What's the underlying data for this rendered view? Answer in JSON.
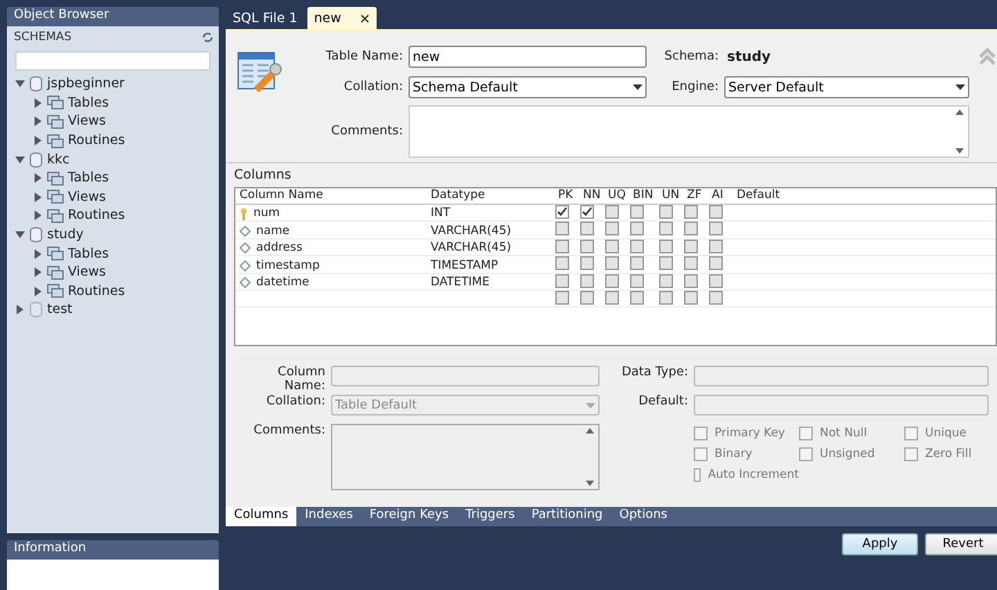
{
  "object_browser": {
    "title": "Object Browser",
    "section": "SCHEMAS",
    "schemas": [
      {
        "name": "jspbeginner",
        "expanded": true,
        "children": [
          {
            "name": "Tables"
          },
          {
            "name": "Views"
          },
          {
            "name": "Routines"
          }
        ]
      },
      {
        "name": "kkc",
        "expanded": true,
        "children": [
          {
            "name": "Tables"
          },
          {
            "name": "Views"
          },
          {
            "name": "Routines"
          }
        ]
      },
      {
        "name": "study",
        "expanded": true,
        "children": [
          {
            "name": "Tables"
          },
          {
            "name": "Views"
          },
          {
            "name": "Routines"
          }
        ]
      },
      {
        "name": "test",
        "expanded": false
      }
    ]
  },
  "information": {
    "title": "Information"
  },
  "editor_tabs": [
    {
      "label": "SQL File 1",
      "selected": false,
      "closable": false
    },
    {
      "label": "new",
      "selected": true,
      "closable": true
    }
  ],
  "table_form": {
    "table_name_label": "Table Name:",
    "table_name": "new",
    "schema_label": "Schema:",
    "schema": "study",
    "collation_label": "Collation:",
    "collation": "Schema Default",
    "engine_label": "Engine:",
    "engine": "Server Default",
    "comments_label": "Comments:"
  },
  "columns_section": {
    "title": "Columns",
    "headers": [
      "Column Name",
      "Datatype",
      "PK",
      "NN",
      "UQ",
      "BIN",
      "UN",
      "ZF",
      "AI",
      "Default"
    ],
    "rows": [
      {
        "kind": "primary",
        "name": "num",
        "datatype": "INT",
        "checks": [
          true,
          true,
          false,
          false,
          false,
          false,
          false
        ]
      },
      {
        "kind": "column",
        "name": "name",
        "datatype": "VARCHAR(45)",
        "checks": [
          false,
          false,
          false,
          false,
          false,
          false,
          false
        ]
      },
      {
        "kind": "column",
        "name": "address",
        "datatype": "VARCHAR(45)",
        "checks": [
          false,
          false,
          false,
          false,
          false,
          false,
          false
        ]
      },
      {
        "kind": "column",
        "name": "timestamp",
        "datatype": "TIMESTAMP",
        "checks": [
          false,
          false,
          false,
          false,
          false,
          false,
          false
        ]
      },
      {
        "kind": "column",
        "name": "datetime",
        "datatype": "DATETIME",
        "checks": [
          false,
          false,
          false,
          false,
          false,
          false,
          false
        ]
      },
      {
        "kind": "new",
        "checks": [
          false,
          false,
          false,
          false,
          false,
          false,
          false
        ]
      }
    ]
  },
  "column_details": {
    "column_name_label": "Column Name:",
    "collation_label": "Collation:",
    "collation": "Table Default",
    "comments_label": "Comments:",
    "data_type_label": "Data Type:",
    "default_label": "Default:",
    "options": [
      {
        "label": "Primary Key",
        "checked": false
      },
      {
        "label": "Not Null",
        "checked": false
      },
      {
        "label": "Unique",
        "checked": false
      },
      {
        "label": "Binary",
        "checked": false
      },
      {
        "label": "Unsigned",
        "checked": false
      },
      {
        "label": "Zero Fill",
        "checked": false
      },
      {
        "label": "Auto Increment",
        "checked": false
      }
    ]
  },
  "bottom_tabs": [
    {
      "label": "Columns",
      "selected": true
    },
    {
      "label": "Indexes",
      "selected": false
    },
    {
      "label": "Foreign Keys",
      "selected": false
    },
    {
      "label": "Triggers",
      "selected": false
    },
    {
      "label": "Partitioning",
      "selected": false
    },
    {
      "label": "Options",
      "selected": false
    }
  ],
  "buttons": [
    {
      "label": "Apply",
      "kind": "primary"
    },
    {
      "label": "Revert",
      "kind": "normal"
    }
  ]
}
